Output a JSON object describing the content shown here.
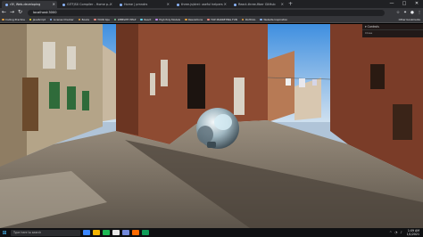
{
  "browser": {
    "tabs": [
      {
        "label": "r3f, Web-developing",
        "active": true
      },
      {
        "label": "GlTFJSX Compiler - Home p...",
        "active": false
      },
      {
        "label": "Home | pmndrs",
        "active": false
      },
      {
        "label": "three-js/drei: useful helpers",
        "active": false
      },
      {
        "label": "React-three-fiber GitHub",
        "active": false
      }
    ],
    "address": "localhost:3000",
    "window_controls": [
      "—",
      "□",
      "✕"
    ]
  },
  "bookmarks": {
    "items": [
      {
        "label": "Coding Practice",
        "color": "#e8a33d"
      },
      {
        "label": "JavaScript",
        "color": "#f7df1e"
      },
      {
        "label": "License Checker",
        "color": "#8ab4f8"
      },
      {
        "label": "Books",
        "color": "#e8a33d"
      },
      {
        "label": "YOUR tips",
        "color": "#f28b82"
      },
      {
        "label": "WEBSITE HELP",
        "color": "#81c995"
      },
      {
        "label": "React",
        "color": "#61dafb"
      },
      {
        "label": "High Poly Models",
        "color": "#c58af9"
      },
      {
        "label": "Resolutions",
        "color": "#e8a33d"
      },
      {
        "label": "TOP MARKETING FUN",
        "color": "#f28b82"
      },
      {
        "label": "Portfolio",
        "color": "#e8a33d"
      },
      {
        "label": "Website Inspiration",
        "color": "#8ab4f8"
      }
    ],
    "other": "Other bookmarks"
  },
  "panel": {
    "title": "▾ Controls",
    "footer": "Close"
  },
  "taskbar": {
    "search_placeholder": "Type here to search",
    "icons": [
      "#3a86ff",
      "#f4b400",
      "#1db954",
      "#e8e8e8",
      "#7289da",
      "#ff6b00",
      "#0f9d58"
    ],
    "time": "1:09 AM",
    "date": "1/1/2021"
  }
}
